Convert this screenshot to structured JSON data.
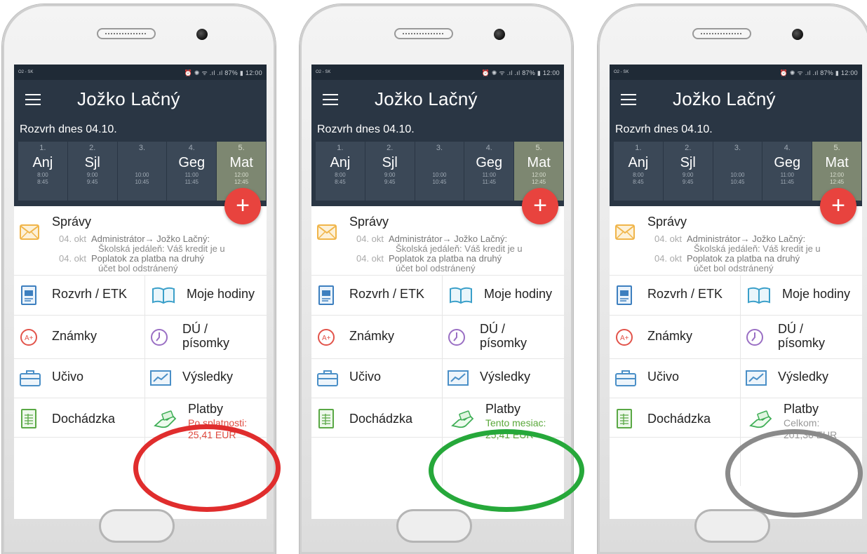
{
  "phones": [
    {
      "status": {
        "carrier": "O2 - SK",
        "right": "⏰ ✺ ᯤ .ıl .ıl 87% ▮ 12:00"
      },
      "title": "Jožko Lačný",
      "schedule_title": "Rozvrh dnes 04.10.",
      "lessons": [
        {
          "num": "1.",
          "subj": "Anj",
          "start": "8:00",
          "end": "8:45",
          "active": false
        },
        {
          "num": "2.",
          "subj": "Sjl",
          "start": "9:00",
          "end": "9:45",
          "active": false
        },
        {
          "num": "3.",
          "subj": "",
          "start": "10:00",
          "end": "10:45",
          "active": false
        },
        {
          "num": "4.",
          "subj": "Geg",
          "start": "11:00",
          "end": "11:45",
          "active": false
        },
        {
          "num": "5.",
          "subj": "Mat",
          "start": "12:00",
          "end": "12:45",
          "active": true
        }
      ],
      "fab": "+",
      "messages": {
        "title": "Správy",
        "items": [
          {
            "date": "04. okt",
            "text": "Administrátor→ Jožko Lačný:",
            "sub": "Školská jedáleň: Váš kredit je u"
          },
          {
            "date": "04. okt",
            "text": "Poplatok za platba na druhý",
            "sub": "účet bol odstránený"
          }
        ]
      },
      "menu": {
        "rozvrh": "Rozvrh / ETK",
        "hodiny": "Moje hodiny",
        "znamky": "Známky",
        "du_line1": "DÚ /",
        "du_line2": "písomky",
        "ucivo": "Učivo",
        "vysledky": "Výsledky",
        "dochadzka": "Dochádzka",
        "platby": "Platby"
      },
      "platby_sub1": "Po splatnosti:",
      "platby_sub2": "25,41 EUR",
      "platby_color": "#e04a3f",
      "ellipse_color": "#e02d2d"
    },
    {
      "status": {
        "carrier": "O2 - SK",
        "right": "⏰ ✺ ᯤ .ıl .ıl 87% ▮ 12:00"
      },
      "title": "Jožko Lačný",
      "schedule_title": "Rozvrh dnes 04.10.",
      "lessons": [
        {
          "num": "1.",
          "subj": "Anj",
          "start": "8:00",
          "end": "8:45",
          "active": false
        },
        {
          "num": "2.",
          "subj": "Sjl",
          "start": "9:00",
          "end": "9:45",
          "active": false
        },
        {
          "num": "3.",
          "subj": "",
          "start": "10:00",
          "end": "10:45",
          "active": false
        },
        {
          "num": "4.",
          "subj": "Geg",
          "start": "11:00",
          "end": "11:45",
          "active": false
        },
        {
          "num": "5.",
          "subj": "Mat",
          "start": "12:00",
          "end": "12:45",
          "active": true
        }
      ],
      "fab": "+",
      "messages": {
        "title": "Správy",
        "items": [
          {
            "date": "04. okt",
            "text": "Administrátor→ Jožko Lačný:",
            "sub": "Školská jedáleň: Váš kredit je u"
          },
          {
            "date": "04. okt",
            "text": "Poplatok za platba na druhý",
            "sub": "účet bol odstránený"
          }
        ]
      },
      "menu": {
        "rozvrh": "Rozvrh / ETK",
        "hodiny": "Moje hodiny",
        "znamky": "Známky",
        "du_line1": "DÚ /",
        "du_line2": "písomky",
        "ucivo": "Učivo",
        "vysledky": "Výsledky",
        "dochadzka": "Dochádzka",
        "platby": "Platby"
      },
      "platby_sub1": "Tento mesiac:",
      "platby_sub2": "25,41 EUR",
      "platby_color": "#5aa83a",
      "ellipse_color": "#26a83a"
    },
    {
      "status": {
        "carrier": "O2 - SK",
        "right": "⏰ ✺ ᯤ .ıl .ıl 87% ▮ 12:00"
      },
      "title": "Jožko Lačný",
      "schedule_title": "Rozvrh dnes 04.10.",
      "lessons": [
        {
          "num": "1.",
          "subj": "Anj",
          "start": "8:00",
          "end": "8:45",
          "active": false
        },
        {
          "num": "2.",
          "subj": "Sjl",
          "start": "9:00",
          "end": "9:45",
          "active": false
        },
        {
          "num": "3.",
          "subj": "",
          "start": "10:00",
          "end": "10:45",
          "active": false
        },
        {
          "num": "4.",
          "subj": "Geg",
          "start": "11:00",
          "end": "11:45",
          "active": false
        },
        {
          "num": "5.",
          "subj": "Mat",
          "start": "12:00",
          "end": "12:45",
          "active": true
        }
      ],
      "fab": "+",
      "messages": {
        "title": "Správy",
        "items": [
          {
            "date": "04. okt",
            "text": "Administrátor→ Jožko Lačný:",
            "sub": "Školská jedáleň: Váš kredit je u"
          },
          {
            "date": "04. okt",
            "text": "Poplatok za platba na druhý",
            "sub": "účet bol odstránený"
          }
        ]
      },
      "menu": {
        "rozvrh": "Rozvrh / ETK",
        "hodiny": "Moje hodiny",
        "znamky": "Známky",
        "du_line1": "DÚ /",
        "du_line2": "písomky",
        "ucivo": "Učivo",
        "vysledky": "Výsledky",
        "dochadzka": "Dochádzka",
        "platby": "Platby"
      },
      "platby_sub1": "Celkom:",
      "platby_sub2": "201,36 EUR",
      "platby_color": "#999999",
      "ellipse_color": "#8a8a8a"
    }
  ]
}
